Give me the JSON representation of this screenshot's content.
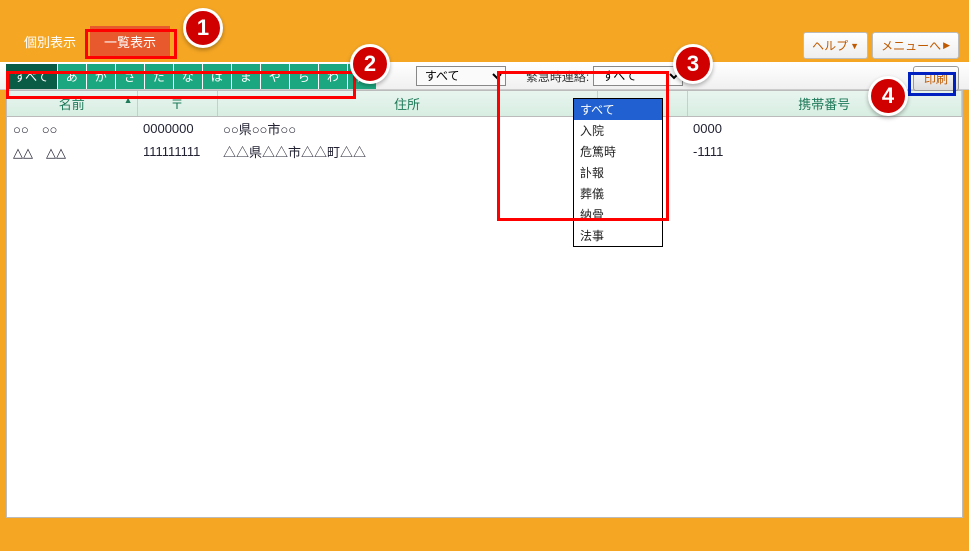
{
  "header": {
    "tab_individual": "個別表示",
    "tab_list": "一覧表示",
    "help_label": "ヘルプ",
    "menu_label": "メニューへ"
  },
  "kana_tabs": [
    "すべて",
    "あ",
    "か",
    "さ",
    "た",
    "な",
    "は",
    "ま",
    "や",
    "ら",
    "わ",
    "他"
  ],
  "filters": {
    "filter1_selected": "すべて",
    "emergency_label": "緊急時連絡:",
    "emergency_selected": "すべて"
  },
  "emergency_options": [
    "すべて",
    "入院",
    "危篤時",
    "訃報",
    "葬儀",
    "納骨",
    "法事"
  ],
  "print_label": "印刷",
  "columns": {
    "name": "名前",
    "postal": "〒",
    "address": "住所",
    "mobile": "携帯番号"
  },
  "rows": [
    {
      "name": "○○　○○",
      "postal": "0000000",
      "address": "○○県○○市○○",
      "mobile_fragment": "0000"
    },
    {
      "name": "△△　△△",
      "postal": "111111111",
      "address": "△△県△△市△△町△△",
      "mobile_fragment": "-1111"
    }
  ],
  "markers": {
    "m1": "1",
    "m2": "2",
    "m3": "3",
    "m4": "4"
  }
}
